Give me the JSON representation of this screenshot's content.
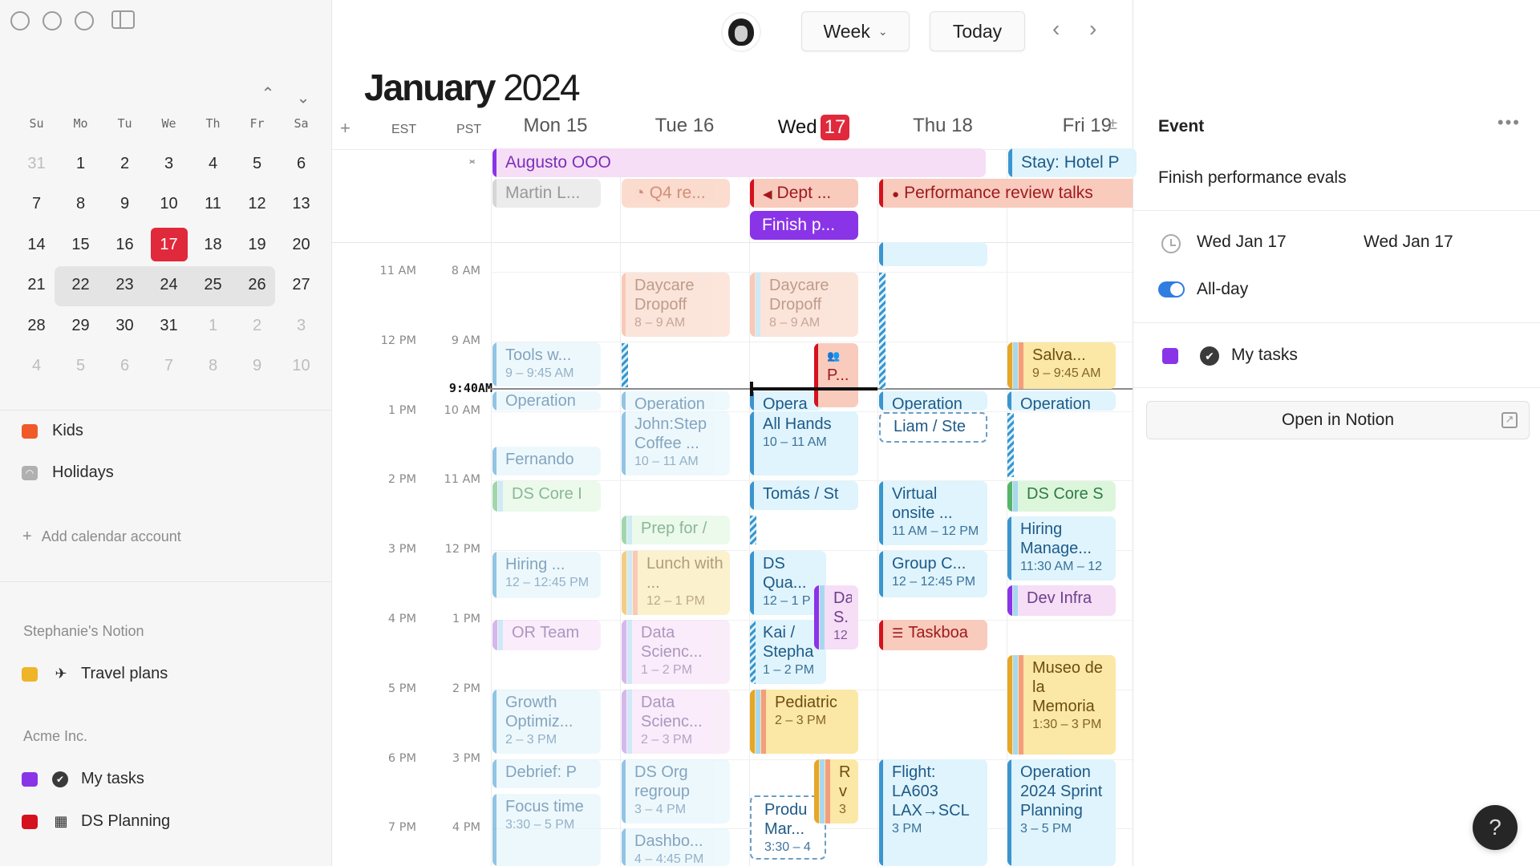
{
  "window": {
    "controls": [
      "close",
      "minimize",
      "zoom"
    ]
  },
  "sidebar": {
    "mini_calendar": {
      "weekdays": [
        "Su",
        "Mo",
        "Tu",
        "We",
        "Th",
        "Fr",
        "Sa"
      ],
      "weeks": [
        [
          {
            "d": "31",
            "m": true
          },
          {
            "d": "1"
          },
          {
            "d": "2"
          },
          {
            "d": "3"
          },
          {
            "d": "4"
          },
          {
            "d": "5"
          },
          {
            "d": "6"
          }
        ],
        [
          {
            "d": "7"
          },
          {
            "d": "8"
          },
          {
            "d": "9"
          },
          {
            "d": "10"
          },
          {
            "d": "11"
          },
          {
            "d": "12"
          },
          {
            "d": "13"
          }
        ],
        [
          {
            "d": "14"
          },
          {
            "d": "15"
          },
          {
            "d": "16"
          },
          {
            "d": "17",
            "today": true
          },
          {
            "d": "18"
          },
          {
            "d": "19"
          },
          {
            "d": "20"
          }
        ],
        [
          {
            "d": "21"
          },
          {
            "d": "22"
          },
          {
            "d": "23"
          },
          {
            "d": "24"
          },
          {
            "d": "25"
          },
          {
            "d": "26"
          },
          {
            "d": "27"
          }
        ],
        [
          {
            "d": "28"
          },
          {
            "d": "29"
          },
          {
            "d": "30"
          },
          {
            "d": "31"
          },
          {
            "d": "1",
            "m": true
          },
          {
            "d": "2",
            "m": true
          },
          {
            "d": "3",
            "m": true
          }
        ],
        [
          {
            "d": "4",
            "m": true
          },
          {
            "d": "5",
            "m": true
          },
          {
            "d": "6",
            "m": true
          },
          {
            "d": "7",
            "m": true
          },
          {
            "d": "8",
            "m": true
          },
          {
            "d": "9",
            "m": true
          },
          {
            "d": "10",
            "m": true
          }
        ]
      ]
    },
    "calendars": [
      {
        "label": "Kids",
        "color": "#f05a28"
      },
      {
        "label": "Holidays",
        "icon": "rss-icon",
        "color": "#b0b0b0"
      }
    ],
    "add_account": "Add calendar account",
    "sections": [
      {
        "title": "Stephanie's Notion",
        "items": [
          {
            "label": "Travel plans",
            "color": "#f0b429",
            "icon": "✈"
          }
        ]
      },
      {
        "title": "Acme Inc.",
        "items": [
          {
            "label": "My tasks",
            "color": "#8a34e8",
            "icon": "✔"
          },
          {
            "label": "DS Planning",
            "color": "#d5111d",
            "icon": "▦"
          }
        ]
      }
    ]
  },
  "toolbar": {
    "view_label": "Week",
    "today_label": "Today",
    "prev": "‹",
    "next": "›"
  },
  "header": {
    "month": "January",
    "year": "2024",
    "add_tz": "+",
    "timezones": [
      "EST",
      "PST"
    ],
    "days": [
      {
        "label": "Mon 15"
      },
      {
        "label": "Tue 16"
      },
      {
        "label": "Wed",
        "num": "17",
        "today": true
      },
      {
        "label": "Thu 18"
      },
      {
        "label": "Fri 19"
      }
    ],
    "expand_icon": "±"
  },
  "time_labels": {
    "est": [
      "11 AM",
      "12 PM",
      "1 PM",
      "2 PM",
      "3 PM",
      "4 PM",
      "5 PM",
      "6 PM",
      "7 PM"
    ],
    "pst": [
      "8 AM",
      "9 AM",
      "10 AM",
      "11 AM",
      "12 PM",
      "1 PM",
      "2 PM",
      "3 PM",
      "4 PM"
    ],
    "now": "9:40AM"
  },
  "all_day_events": [
    {
      "title": "Augusto OOO",
      "color": "pink"
    },
    {
      "title": "Stay: Hotel P",
      "color": "blue"
    },
    {
      "title": "Martin L...",
      "color": "gray"
    },
    {
      "title": "Q4 re...",
      "color": "peach",
      "icon": "◔"
    },
    {
      "title": "Dept ...",
      "color": "red",
      "icon": "📢"
    },
    {
      "title": "Finish p...",
      "color": "purple-solid"
    },
    {
      "title": "Performance review talks",
      "color": "red",
      "icon": "💬"
    }
  ],
  "events": [
    {
      "day": 0,
      "title": "Tools w...",
      "time": "9 – 9:45 AM",
      "past": true
    },
    {
      "day": 0,
      "title": "Operation",
      "past": true
    },
    {
      "day": 0,
      "title": "Fernando",
      "past": true
    },
    {
      "day": 0,
      "title": "DS Core I",
      "past": true
    },
    {
      "day": 0,
      "title": "Hiring ...",
      "time": "12 – 12:45 PM",
      "past": true
    },
    {
      "day": 0,
      "title": "OR Team",
      "past": true
    },
    {
      "day": 0,
      "title": "Growth Optimiz...",
      "time": "2 – 3 PM",
      "past": true
    },
    {
      "day": 0,
      "title": "Debrief: P",
      "past": true
    },
    {
      "day": 0,
      "title": "Focus time",
      "time": "3:30 – 5 PM",
      "past": true
    },
    {
      "day": 1,
      "title": "Daycare Dropoff",
      "time": "8 – 9 AM",
      "past": true
    },
    {
      "day": 1,
      "title": "Operation",
      "past": true
    },
    {
      "day": 1,
      "title": "John:Step Coffee ...",
      "time": "10 – 11 AM",
      "past": true
    },
    {
      "day": 1,
      "title": "Prep for /",
      "past": true
    },
    {
      "day": 1,
      "title": "Lunch with ...",
      "time": "12 – 1 PM",
      "past": true
    },
    {
      "day": 1,
      "title": "Data Scienc...",
      "time": "1 – 2 PM",
      "past": true
    },
    {
      "day": 1,
      "title": "Data Scienc...",
      "time": "2 – 3 PM",
      "past": true
    },
    {
      "day": 1,
      "title": "DS Org regroup",
      "time": "3 – 4 PM",
      "past": true
    },
    {
      "day": 1,
      "title": "Dashbo...",
      "time": "4 – 4:45 PM",
      "past": true
    },
    {
      "day": 2,
      "title": "Daycare Dropoff",
      "time": "8 – 9 AM",
      "past": true
    },
    {
      "day": 2,
      "title": "P...",
      "icon": "👥"
    },
    {
      "day": 2,
      "title": "Opera"
    },
    {
      "day": 2,
      "title": "All Hands",
      "time": "10 – 11 AM"
    },
    {
      "day": 2,
      "title": "Tomás / St"
    },
    {
      "day": 2,
      "title": "DS Qua...",
      "time": "12 – 1 P"
    },
    {
      "day": 2,
      "title": "Da S.",
      "time": "12"
    },
    {
      "day": 2,
      "title": "Kai / Stepha",
      "time": "1 – 2 PM"
    },
    {
      "day": 2,
      "title": "Pediatric",
      "time": "2 – 3 PM"
    },
    {
      "day": 2,
      "title": "R v",
      "time": "3"
    },
    {
      "day": 2,
      "title": "Produ Mar...",
      "time": "3:30 – 4"
    },
    {
      "day": 3,
      "title": "Operation"
    },
    {
      "day": 3,
      "title": "Liam / Ste"
    },
    {
      "day": 3,
      "title": "Virtual onsite ...",
      "time": "11 AM – 12 PM"
    },
    {
      "day": 3,
      "title": "Group C...",
      "time": "12 – 12:45 PM"
    },
    {
      "day": 3,
      "title": "Taskboa",
      "icon": "☰"
    },
    {
      "day": 3,
      "title": "Flight: LA603 LAX→SCL",
      "time": "3 PM"
    },
    {
      "day": 4,
      "title": "Salva...",
      "time": "9 – 9:45 AM"
    },
    {
      "day": 4,
      "title": "Operation"
    },
    {
      "day": 4,
      "title": "DS Core S"
    },
    {
      "day": 4,
      "title": "Hiring Manage...",
      "time": "11:30 AM – 12"
    },
    {
      "day": 4,
      "title": "Dev Infra"
    },
    {
      "day": 4,
      "title": "Museo de la Memoria",
      "time": "1:30 – 3 PM"
    },
    {
      "day": 4,
      "title": "Operation 2024 Sprint Planning",
      "time": "3 – 5 PM"
    }
  ],
  "panel": {
    "title": "Event",
    "more": "•••",
    "event_name": "Finish performance evals",
    "start_date": "Wed Jan 17",
    "end_date": "Wed Jan 17",
    "all_day_label": "All-day",
    "all_day": true,
    "calendar": "My tasks",
    "calendar_color": "#8a34e8",
    "open_button": "Open in Notion"
  },
  "help": "?"
}
